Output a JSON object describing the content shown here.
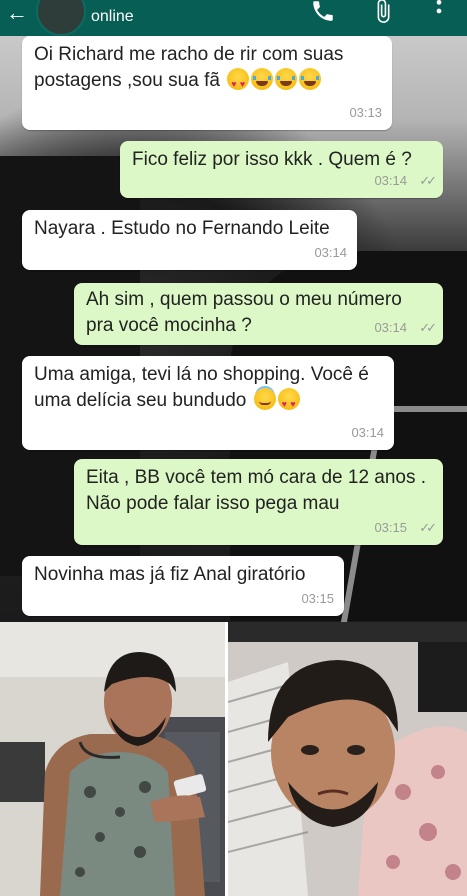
{
  "header": {
    "status": "online",
    "icons": [
      "back-arrow-icon",
      "phone-icon",
      "paperclip-icon",
      "more-vert-icon"
    ]
  },
  "messages": [
    {
      "dir": "in",
      "text": "Oi Richard  me racho de rir com suas postagens ,sou sua fã",
      "emojis": [
        "heart-eyes",
        "tears-of-joy",
        "tears-of-joy",
        "tears-of-joy"
      ],
      "time": "03:13"
    },
    {
      "dir": "out",
      "text": "Fico feliz por isso kkk . Quem é ?",
      "time": "03:14",
      "status": "read-double-check"
    },
    {
      "dir": "in",
      "text": "Nayara . Estudo no Fernando Leite",
      "time": "03:14"
    },
    {
      "dir": "out",
      "text": "Ah sim , quem passou o meu número pra você mocinha ?",
      "time": "03:14",
      "status": "read-double-check"
    },
    {
      "dir": "in",
      "text": "Uma amiga, tevi lá no shopping. Você é uma delícia seu bundudo",
      "emojis": [
        "smiling-with-halo",
        "heart-eyes"
      ],
      "time": "03:14"
    },
    {
      "dir": "out",
      "text": "Eita , BB você tem mó cara de 12 anos . Não pode falar isso pega mau",
      "time": "03:15",
      "status": "read-double-check"
    },
    {
      "dir": "in",
      "text": "Novinha mas já fiz Anal giratório",
      "time": "03:15"
    }
  ],
  "photos": [
    {
      "name": "man-in-tank-top-with-phone"
    },
    {
      "name": "man-lying-on-pillow"
    }
  ],
  "colors": {
    "header": "#075e54",
    "incoming_bubble": "#ffffff",
    "outgoing_bubble": "#dcf8c6",
    "meta_text": "#9a9a9a"
  }
}
